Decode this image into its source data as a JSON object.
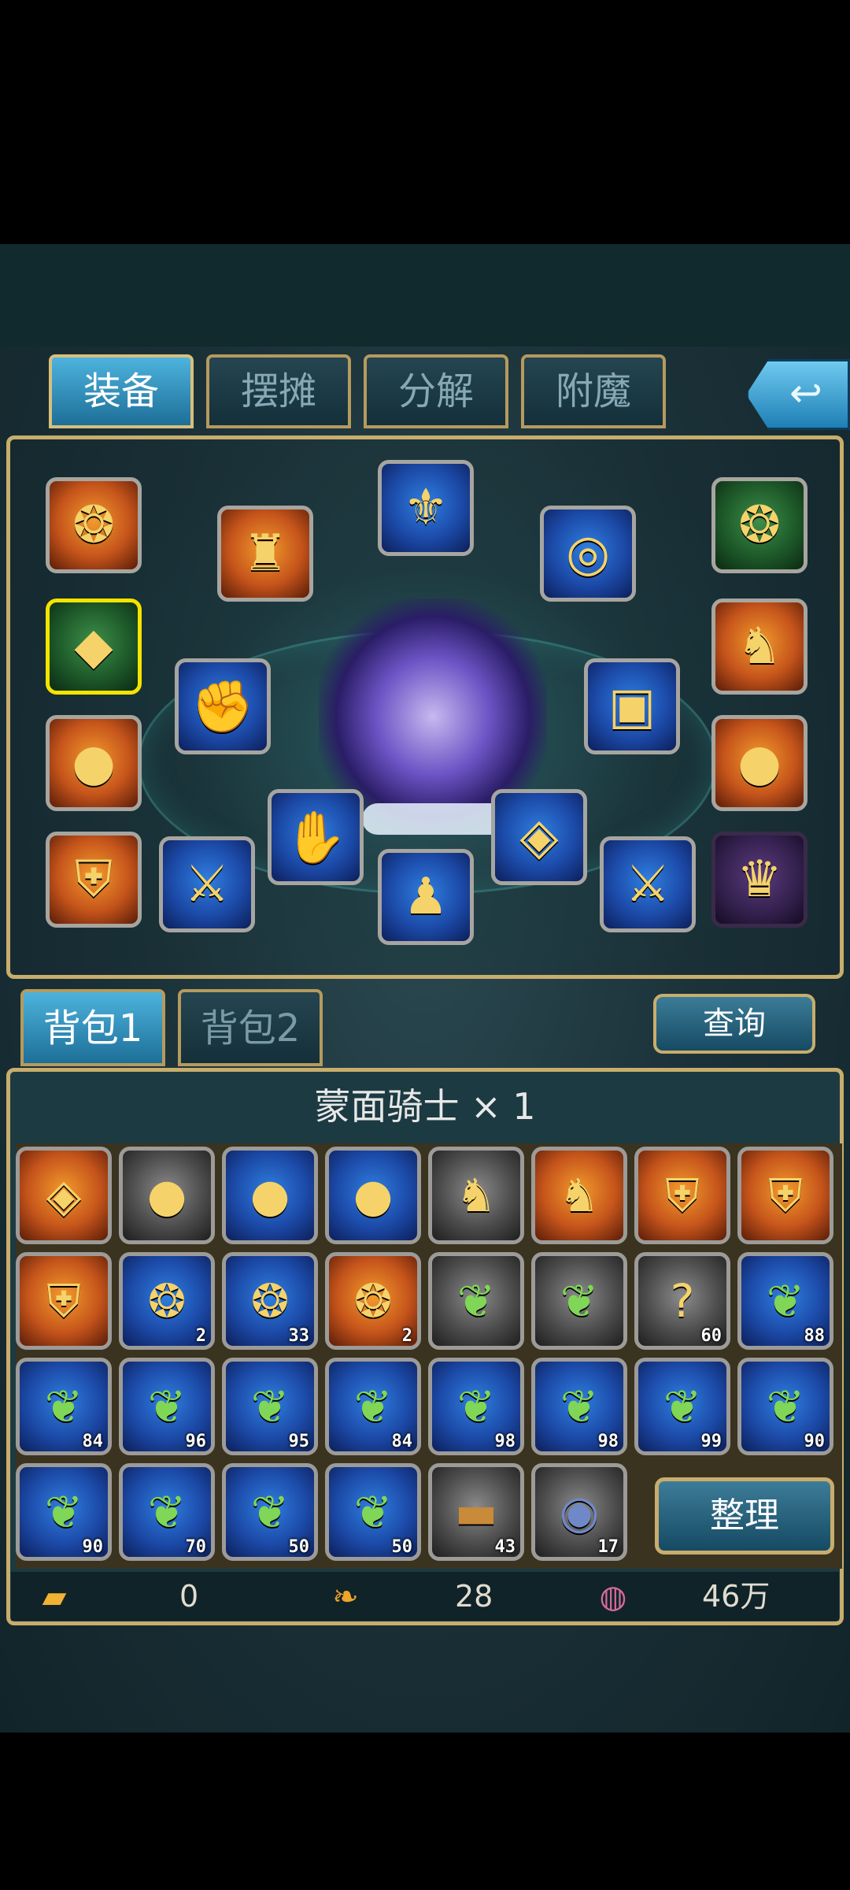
{
  "tabs": [
    {
      "label": "装备",
      "active": true
    },
    {
      "label": "摆摊",
      "active": false
    },
    {
      "label": "分解",
      "active": false
    },
    {
      "label": "附魔",
      "active": false
    }
  ],
  "back_icon": "return-arrow-icon",
  "equipment_slots": [
    {
      "icon": "chain-ring-icon",
      "glyph": "❂"
    },
    {
      "icon": "red-cape-icon",
      "glyph": "♜"
    },
    {
      "icon": "wing-helmet-icon",
      "glyph": "⚜"
    },
    {
      "icon": "bracelet-icon",
      "glyph": "◎"
    },
    {
      "icon": "chain-ring-icon",
      "glyph": "❂"
    },
    {
      "icon": "fox-pet-icon",
      "glyph": "◆"
    },
    {
      "icon": "gold-ring-icon",
      "glyph": "●"
    },
    {
      "icon": "gauntlet-icon",
      "glyph": "✊"
    },
    {
      "icon": "horse-mount-icon",
      "glyph": "♞"
    },
    {
      "icon": "belt-icon",
      "glyph": "▣"
    },
    {
      "icon": "gold-ring-icon",
      "glyph": "●"
    },
    {
      "icon": "glove-icon",
      "glyph": "✋"
    },
    {
      "icon": "armor-icon",
      "glyph": "⛨"
    },
    {
      "icon": "sword-icon",
      "glyph": "⚔"
    },
    {
      "icon": "boots-icon",
      "glyph": "♟"
    },
    {
      "icon": "pauldron-icon",
      "glyph": "◈"
    },
    {
      "icon": "sword-icon",
      "glyph": "⚔"
    },
    {
      "icon": "vip-crown-icon",
      "glyph": "♛"
    }
  ],
  "bag_tabs": [
    {
      "label": "背包1",
      "active": true
    },
    {
      "label": "背包2",
      "active": false
    }
  ],
  "query_button": "查询",
  "item_title": "蒙面骑士 × 1",
  "inventory": [
    {
      "icon": "pauldron-icon",
      "glyph": "◈",
      "count": ""
    },
    {
      "icon": "gold-ring-icon",
      "glyph": "●",
      "count": ""
    },
    {
      "icon": "gold-ring-icon",
      "glyph": "●",
      "count": ""
    },
    {
      "icon": "gold-ring-icon",
      "glyph": "●",
      "count": ""
    },
    {
      "icon": "horse-mount-icon",
      "glyph": "♞",
      "count": ""
    },
    {
      "icon": "horse-mount-icon",
      "glyph": "♞",
      "count": ""
    },
    {
      "icon": "armor-icon",
      "glyph": "⛨",
      "count": ""
    },
    {
      "icon": "armor-icon",
      "glyph": "⛨",
      "count": ""
    },
    {
      "icon": "armor-icon",
      "glyph": "⛨",
      "count": ""
    },
    {
      "icon": "chain-ring-icon",
      "glyph": "❂",
      "count": "2"
    },
    {
      "icon": "chain-ring-icon",
      "glyph": "❂",
      "count": "33"
    },
    {
      "icon": "chain-ring-icon",
      "glyph": "❂",
      "count": "2"
    },
    {
      "icon": "herb-icon",
      "glyph": "❦",
      "count": ""
    },
    {
      "icon": "herb-icon",
      "glyph": "❦",
      "count": ""
    },
    {
      "icon": "mystery-item-icon",
      "glyph": "?",
      "count": "60"
    },
    {
      "icon": "herb-icon",
      "glyph": "❦",
      "count": "88"
    },
    {
      "icon": "herb-icon",
      "glyph": "❦",
      "count": "84"
    },
    {
      "icon": "herb-icon",
      "glyph": "❦",
      "count": "96"
    },
    {
      "icon": "herb-icon",
      "glyph": "❦",
      "count": "95"
    },
    {
      "icon": "herb-icon",
      "glyph": "❦",
      "count": "84"
    },
    {
      "icon": "herb-icon",
      "glyph": "❦",
      "count": "98"
    },
    {
      "icon": "herb-icon",
      "glyph": "❦",
      "count": "98"
    },
    {
      "icon": "herb-icon",
      "glyph": "❦",
      "count": "99"
    },
    {
      "icon": "herb-icon",
      "glyph": "❦",
      "count": "90"
    },
    {
      "icon": "herb-icon",
      "glyph": "❦",
      "count": "90"
    },
    {
      "icon": "herb-icon",
      "glyph": "❦",
      "count": "70"
    },
    {
      "icon": "herb-icon",
      "glyph": "❦",
      "count": "50"
    },
    {
      "icon": "herb-icon",
      "glyph": "❦",
      "count": "50"
    },
    {
      "icon": "wood-log-icon",
      "glyph": "▬",
      "count": "43"
    },
    {
      "icon": "ore-stone-icon",
      "glyph": "◉",
      "count": "17"
    }
  ],
  "sort_button": "整理",
  "currency": [
    {
      "icon": "gold-bar-icon",
      "glyph": "▰",
      "value": "0"
    },
    {
      "icon": "leaf-token-icon",
      "glyph": "❧",
      "value": "28"
    },
    {
      "icon": "coin-icon",
      "glyph": "◍",
      "value": "46万"
    }
  ]
}
